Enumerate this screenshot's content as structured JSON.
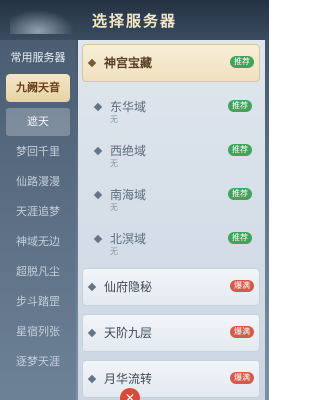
{
  "header": {
    "title": "选择服务器"
  },
  "sidebar": {
    "title": "常用服务器",
    "items": [
      {
        "label": "九阙天音",
        "state": "active"
      },
      {
        "label": "遮天",
        "state": "secondary"
      },
      {
        "label": "梦回千里",
        "state": "normal"
      },
      {
        "label": "仙路漫漫",
        "state": "normal"
      },
      {
        "label": "天涯追梦",
        "state": "normal"
      },
      {
        "label": "神域无边",
        "state": "normal"
      },
      {
        "label": "超脱凡尘",
        "state": "normal"
      },
      {
        "label": "步斗踏罡",
        "state": "normal"
      },
      {
        "label": "星宿列张",
        "state": "normal"
      },
      {
        "label": "逐梦天涯",
        "state": "normal"
      }
    ]
  },
  "list": {
    "groups": [
      {
        "name": "神宫宝藏",
        "badge": "推荐",
        "badge_color": "green"
      },
      {
        "name": "仙府隐秘",
        "badge": "爆满",
        "badge_color": "red"
      },
      {
        "name": "天阶九层",
        "badge": "爆满",
        "badge_color": "red"
      },
      {
        "name": "月华流转",
        "badge": "爆满",
        "badge_color": "red"
      }
    ],
    "servers": [
      {
        "name": "东华域",
        "status": "无",
        "badge": "推荐",
        "badge_color": "green"
      },
      {
        "name": "西绝域",
        "status": "无",
        "badge": "推荐",
        "badge_color": "green"
      },
      {
        "name": "南海域",
        "status": "无",
        "badge": "推荐",
        "badge_color": "green"
      },
      {
        "name": "北溟域",
        "status": "无",
        "badge": "推荐",
        "badge_color": "green"
      }
    ]
  },
  "footer": {
    "close_icon": "close-icon"
  }
}
